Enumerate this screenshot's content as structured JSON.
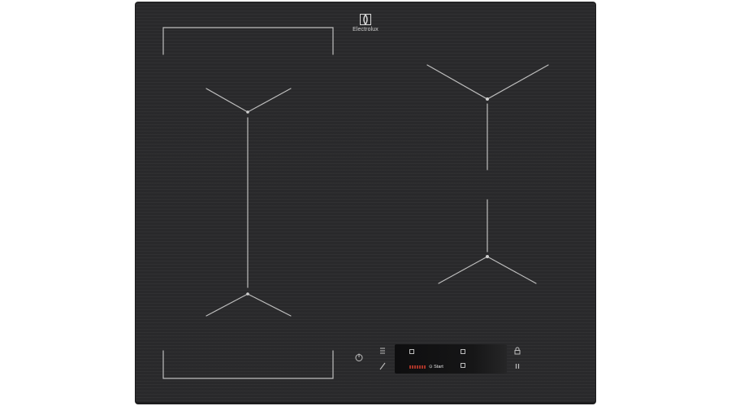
{
  "brand": {
    "name": "Electrolux",
    "logo_icon": "electrolux-logo-icon"
  },
  "control_panel": {
    "start_label": "Start",
    "icons": {
      "power": "power-icon",
      "menu": "menu-icon",
      "bridge": "bridge-icon",
      "lock": "lock-icon",
      "pause": "pause-icon"
    }
  },
  "colors": {
    "surface": "#29292b",
    "print_lines": "#bdbdbd",
    "display_red": "#c0392b"
  }
}
